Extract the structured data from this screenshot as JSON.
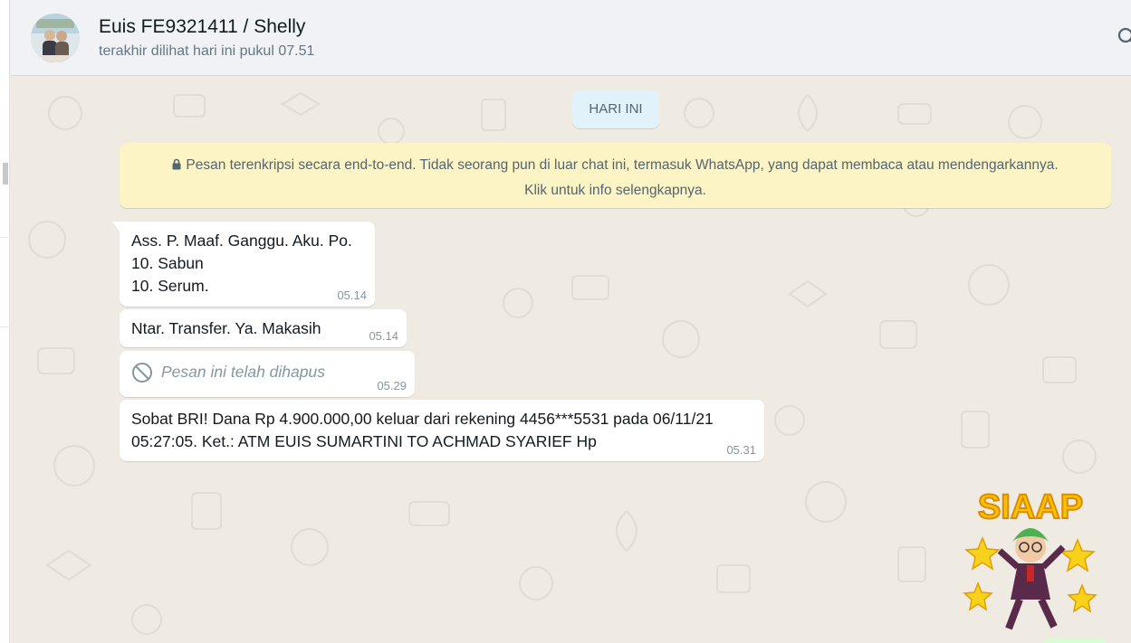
{
  "header": {
    "contact_name": "Euis FE9321411 / Shelly",
    "last_seen": "terakhir dilihat hari ini pukul 07.51"
  },
  "chat": {
    "date_chip": "HARI INI",
    "encryption_notice_line1": "Pesan terenkripsi secara end-to-end. Tidak seorang pun di luar chat ini, termasuk WhatsApp, yang dapat membaca atau mendengarkannya.",
    "encryption_notice_line2": "Klik untuk info selengkapnya.",
    "messages": [
      {
        "lines": [
          "Ass. P. Maaf. Ganggu. Aku. Po.",
          "10. Sabun",
          "10. Serum."
        ],
        "time": "05.14"
      },
      {
        "lines": [
          "Ntar. Transfer. Ya. Makasih"
        ],
        "time": "05.14"
      },
      {
        "deleted_text": "Pesan ini telah dihapus",
        "time": "05.29"
      },
      {
        "lines": [
          "Sobat BRI! Dana Rp 4.900.000,00 keluar dari rekening 4456***5531 pada 06/11/21",
          "05:27:05. Ket.: ATM  EUIS SUMARTINI TO ACHMAD SYARIEF Hp"
        ],
        "time": "05.31"
      }
    ],
    "sticker_text": "SIAAP"
  },
  "colors": {
    "chat_bg": "#efeae2",
    "bubble_in": "#ffffff",
    "date_chip_bg": "#e1f2fb",
    "encryption_bg": "#fdf4c5",
    "header_bg": "#f0f2f5"
  },
  "icons": {
    "lock": "lock-icon",
    "deleted": "ban-icon",
    "search": "search-icon"
  }
}
